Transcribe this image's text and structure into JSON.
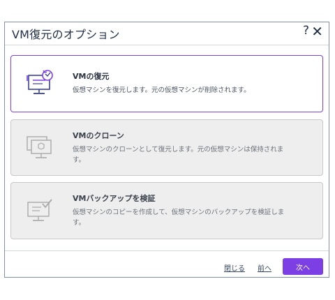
{
  "dialog": {
    "title": "VM復元のオプション",
    "help": "?",
    "close": "✕"
  },
  "options": [
    {
      "title": "VMの復元",
      "description": "仮想マシンを復元します。元の仮想マシンが削除されます。",
      "icon": "vm-restore-icon",
      "selected": true
    },
    {
      "title": "VMのクローン",
      "description": "仮想マシンのクローンとして復元します。元の仮想マシンは保持されます。",
      "icon": "vm-clone-icon",
      "selected": false
    },
    {
      "title": "VMバックアップを検証",
      "description": "仮想マシンのコピーを作成して、仮想マシンのバックアップを検証します。",
      "icon": "vm-verify-icon",
      "selected": false
    }
  ],
  "footer": {
    "close_label": "閉じる",
    "back_label": "前へ",
    "next_label": "次へ"
  },
  "colors": {
    "accent": "#7b3fe4",
    "border": "#7f8ea6",
    "disabled_bg": "#eeeeee"
  }
}
